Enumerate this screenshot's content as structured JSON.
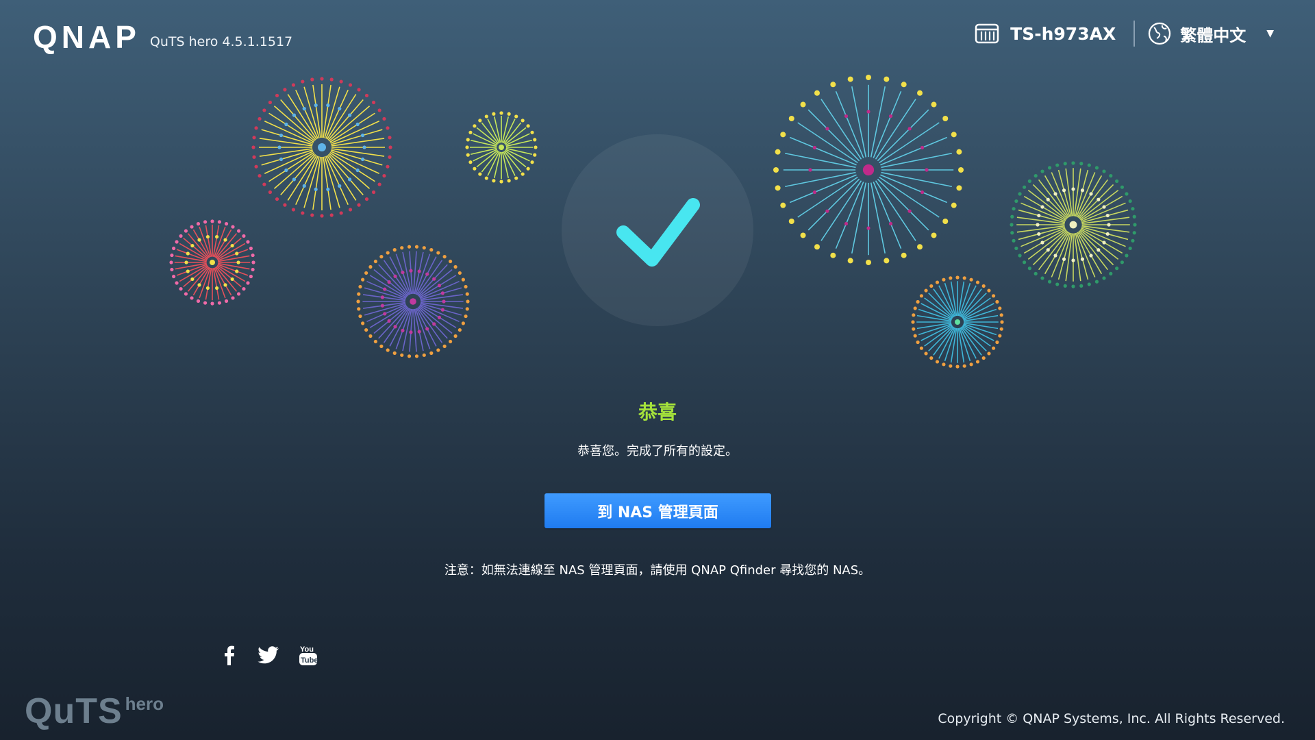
{
  "header": {
    "brand": "QNAP",
    "version": "QuTS hero 4.5.1.1517",
    "device_name": "TS-h973AX",
    "language": "繁體中文",
    "icons": [
      "nas-device-icon",
      "globe-icon",
      "caret-down-icon"
    ]
  },
  "main": {
    "title": "恭喜",
    "message": "恭喜您。完成了所有的設定。",
    "button_label": "到 NAS 管理頁面",
    "note": "注意：如無法連線至 NAS 管理頁面，請使用 QNAP Qfinder 尋找您的 NAS。"
  },
  "social": {
    "icons": [
      "facebook-icon",
      "twitter-icon",
      "youtube-icon"
    ]
  },
  "footer": {
    "logo_main": "QuTS",
    "logo_sub": "hero",
    "copyright": "Copyright © QNAP Systems, Inc. All Rights Reserved."
  },
  "colors": {
    "title_green": "#a6e33b",
    "button_blue": "#1f7bf0",
    "check_cyan": "#48e6f0"
  }
}
